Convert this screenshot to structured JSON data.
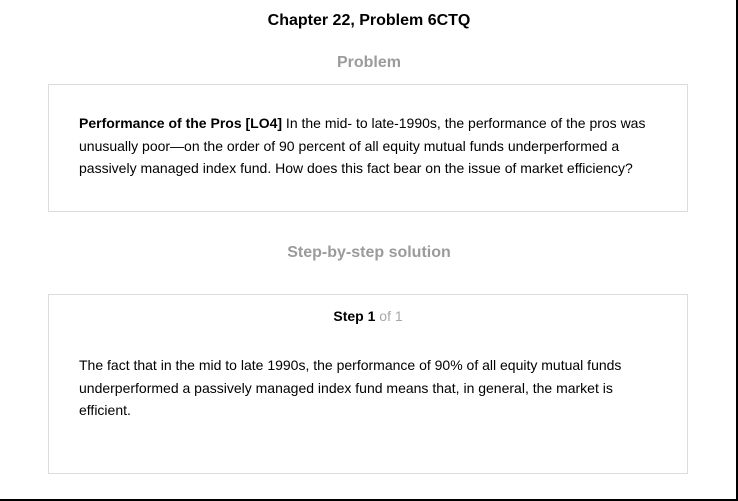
{
  "page": {
    "title": "Chapter 22, Problem 6CTQ"
  },
  "problem": {
    "heading": "Problem",
    "bold_lead": "Performance of the Pros [LO4]",
    "body": " In the mid- to late-1990s, the performance of the pros was unusually poor—on the order of 90 percent of all equity mutual funds underperformed a passively managed index fund. How does this fact bear on the issue of market efficiency?"
  },
  "solution": {
    "heading": "Step-by-step solution",
    "step_label": "Step",
    "step_number": "1",
    "step_total": " of 1",
    "body": "The fact that in the mid to late 1990s, the performance of 90% of all equity mutual funds underperformed a passively managed index fund means that, in general, the market is efficient."
  }
}
